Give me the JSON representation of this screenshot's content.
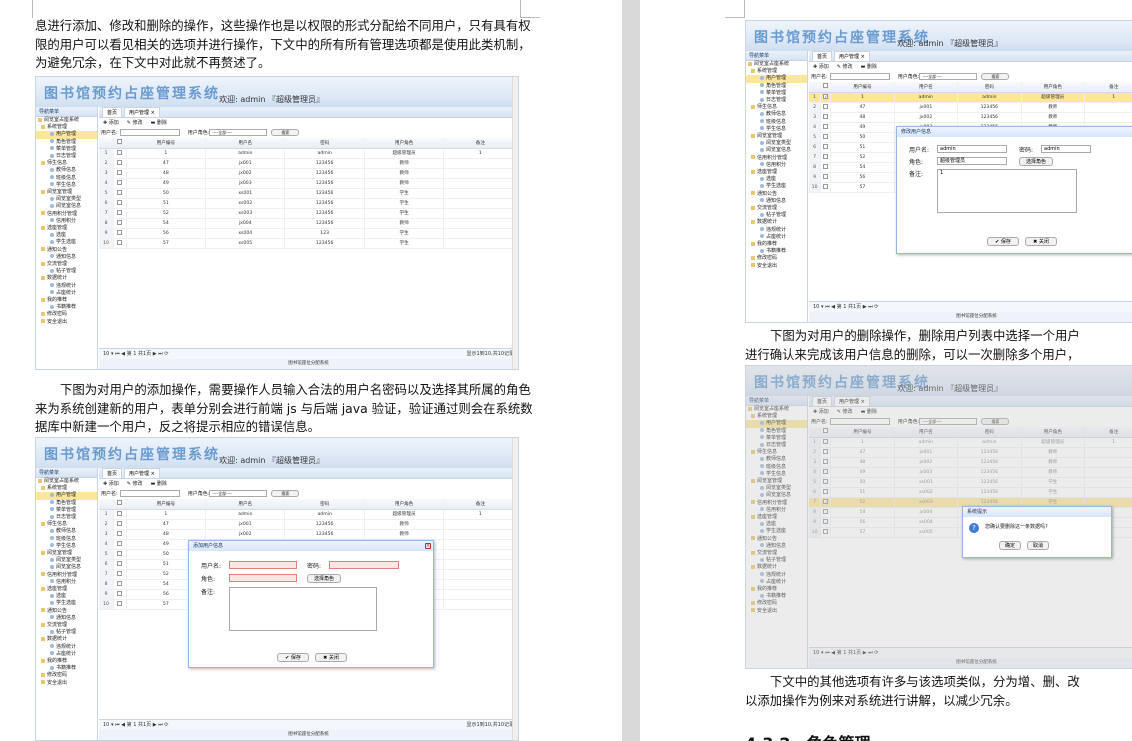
{
  "page_left": {
    "para_top": [
      "息进行添加、修改和删除的操作，这些操作也是以权限的形式分配给不同用户，只有具有权",
      "限的用户可以看见相关的选项并进行操作，下文中的所有所有管理选项都是使用此类机制，",
      "为避免冗余，在下文中对此就不再赘述了。"
    ],
    "para_mid": [
      "下图为对用户的添加操作，需要操作人员输入合法的用户名密码以及选择其所属的角色",
      "来为系统创建新的用户，表单分别会进行前端 js 与后端 java 验证，验证通过则会在系统数",
      "据库中新建一个用户，反之将提示相应的错误信息。"
    ]
  },
  "page_right": {
    "para_mid": [
      "下图为对用户的删除操作，删除用户列表中选择一个用户",
      "进行确认来完成该用户信息的删除，可以一次删除多个用户，"
    ],
    "para_bottom": [
      "下文中的其他选项有许多与该选项类似，分为增、删、改",
      "以添加操作为例来对系统进行讲解，以减少冗余。"
    ],
    "heading": "4.3.2　角色管理"
  },
  "app": {
    "title": "图书馆预约占座管理系统",
    "welcome": "欢迎: admin 『超级管理员』",
    "nav_header": "导航菜单",
    "tab_home": "首页",
    "tab_user": "用户管理 ×",
    "toolbar": {
      "add": "添加",
      "edit": "修改",
      "delete": "删除"
    },
    "filter": {
      "username_label": "用户名:",
      "role_label": "用户角色:",
      "role_value": "----全部----",
      "search": "搜索"
    },
    "columns": [
      "用户编号",
      "用户名",
      "密码",
      "用户角色",
      "备注"
    ],
    "rows": [
      [
        "1",
        "admin",
        "admin",
        "超级管理员",
        "1"
      ],
      [
        "47",
        "jx001",
        "123456",
        "教师",
        ""
      ],
      [
        "48",
        "jx002",
        "123456",
        "教师",
        ""
      ],
      [
        "49",
        "jx003",
        "123456",
        "教师",
        ""
      ],
      [
        "50",
        "xs001",
        "123456",
        "学生",
        ""
      ],
      [
        "51",
        "xs002",
        "123456",
        "学生",
        ""
      ],
      [
        "52",
        "xs003",
        "123456",
        "学生",
        ""
      ],
      [
        "54",
        "jx004",
        "123456",
        "教师",
        ""
      ],
      [
        "56",
        "xs004",
        "123",
        "学生",
        ""
      ],
      [
        "57",
        "xs005",
        "123456",
        "学生",
        ""
      ]
    ],
    "pager": {
      "size": "10",
      "page_label": "第",
      "page": "1",
      "total_pages": "共1页",
      "info": "显示1到10,共10记录"
    },
    "footer": "图书馆座位分配系统",
    "tree": [
      {
        "t": "阅览室占座系统",
        "lvl": 0
      },
      {
        "t": "系统管理",
        "lvl": 1
      },
      {
        "t": "用户管理",
        "lvl": 2,
        "sel": true
      },
      {
        "t": "角色管理",
        "lvl": 2
      },
      {
        "t": "菜单管理",
        "lvl": 2
      },
      {
        "t": "日志管理",
        "lvl": 2
      },
      {
        "t": "师生信息",
        "lvl": 1
      },
      {
        "t": "教师信息",
        "lvl": 2
      },
      {
        "t": "班级信息",
        "lvl": 2
      },
      {
        "t": "学生信息",
        "lvl": 2
      },
      {
        "t": "阅览室管理",
        "lvl": 1
      },
      {
        "t": "阅览室类型",
        "lvl": 2
      },
      {
        "t": "阅览室信息",
        "lvl": 2
      },
      {
        "t": "信用积分管理",
        "lvl": 1
      },
      {
        "t": "信用积分",
        "lvl": 2
      },
      {
        "t": "选座管理",
        "lvl": 1
      },
      {
        "t": "选座",
        "lvl": 2
      },
      {
        "t": "学生选座",
        "lvl": 2
      },
      {
        "t": "通知公告",
        "lvl": 1
      },
      {
        "t": "通知信息",
        "lvl": 2
      },
      {
        "t": "交流管理",
        "lvl": 1
      },
      {
        "t": "帖子管理",
        "lvl": 2
      },
      {
        "t": "数据统计",
        "lvl": 1
      },
      {
        "t": "违规统计",
        "lvl": 2
      },
      {
        "t": "占座统计",
        "lvl": 2
      },
      {
        "t": "我的推荐",
        "lvl": 1
      },
      {
        "t": "书籍推荐",
        "lvl": 2
      },
      {
        "t": "修改密码",
        "lvl": 1
      },
      {
        "t": "安全退出",
        "lvl": 1
      }
    ]
  },
  "dialog_add": {
    "title": "添加用户信息",
    "username": "用户名:",
    "password": "密码:",
    "role": "角色:",
    "role_btn": "选择角色",
    "remark": "备注:",
    "save": "保存",
    "close": "关闭"
  },
  "dialog_edit": {
    "title": "修改用户信息",
    "username": "用户名:",
    "username_val": "admin",
    "password": "密码:",
    "password_val": "admin",
    "role": "角色:",
    "role_val": "超级管理员",
    "role_btn": "选择角色",
    "remark": "备注:",
    "remark_val": "1",
    "save": "保存",
    "close": "关闭"
  },
  "dialog_delete": {
    "title": "系统提示",
    "message": "您确认要删除这一条数据吗?",
    "ok": "确定",
    "cancel": "取消"
  }
}
